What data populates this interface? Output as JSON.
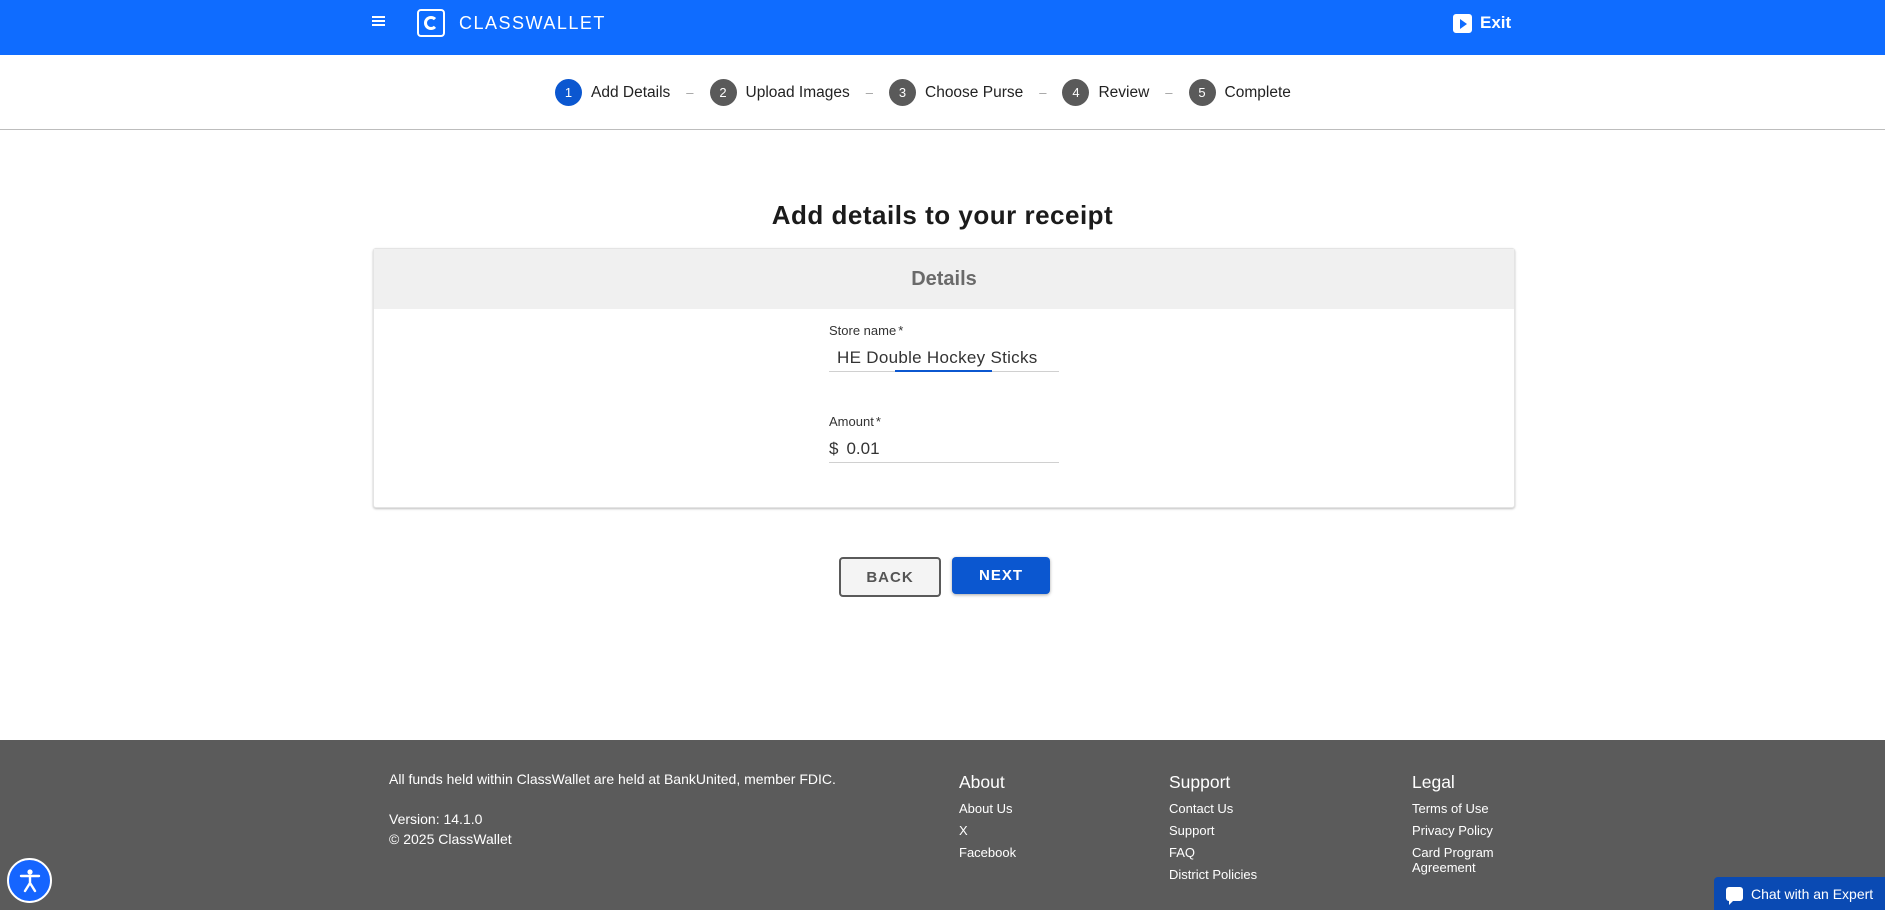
{
  "header": {
    "brand": "CLASSWALLET",
    "exit_label": "Exit"
  },
  "stepper": {
    "steps": [
      {
        "num": "1",
        "label": "Add Details",
        "active": true
      },
      {
        "num": "2",
        "label": "Upload Images",
        "active": false
      },
      {
        "num": "3",
        "label": "Choose Purse",
        "active": false
      },
      {
        "num": "4",
        "label": "Review",
        "active": false
      },
      {
        "num": "5",
        "label": "Complete",
        "active": false
      }
    ],
    "separator": "–"
  },
  "main": {
    "title": "Add details to your receipt",
    "card_header": "Details",
    "store_label": "Store name",
    "store_value": "HE Double Hockey Sticks",
    "amount_label": "Amount",
    "amount_prefix": "$",
    "amount_value": "0.01",
    "required_mark": "*",
    "back_label": "BACK",
    "next_label": "NEXT"
  },
  "footer": {
    "fdic_text": "All funds held within ClassWallet are held at BankUnited, member FDIC.",
    "version": "Version: 14.1.0",
    "copyright": "© 2025 ClassWallet",
    "about": {
      "title": "About",
      "links": [
        "About Us",
        "X",
        "Facebook"
      ]
    },
    "support": {
      "title": "Support",
      "links": [
        "Contact Us",
        "Support",
        "FAQ",
        "District Policies"
      ]
    },
    "legal": {
      "title": "Legal",
      "links": [
        "Terms of Use",
        "Privacy Policy",
        "Card Program Agreement"
      ]
    }
  },
  "chat_label": "Chat with an Expert",
  "colors": {
    "topbar": "#0f6cff",
    "primary": "#0b57d0",
    "footer": "#5b5b5b"
  },
  "icons": [
    "menu-icon",
    "classwallet-logo-icon",
    "exit-icon",
    "accessibility-icon",
    "chat-icon"
  ]
}
